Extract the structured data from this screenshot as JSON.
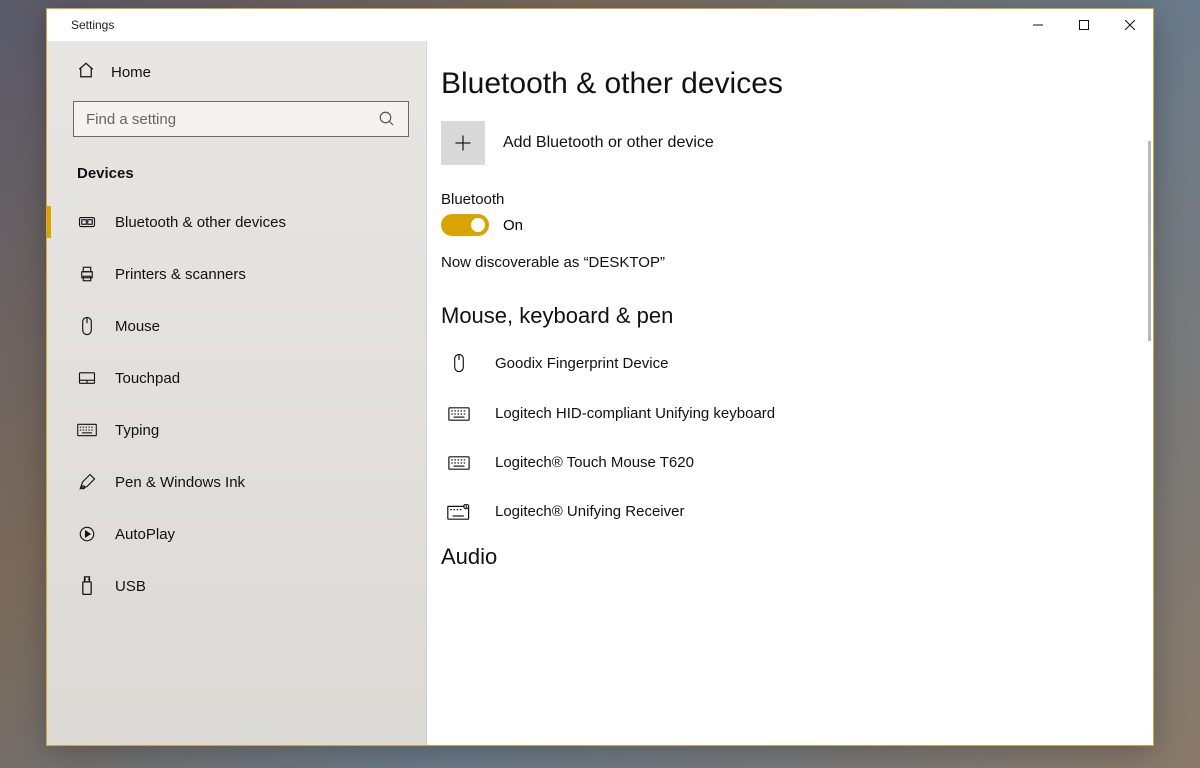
{
  "titlebar": {
    "title": "Settings"
  },
  "sidebar": {
    "home": "Home",
    "search_placeholder": "Find a setting",
    "category": "Devices",
    "items": [
      {
        "id": "bluetooth",
        "label": "Bluetooth & other devices",
        "icon": "bluetooth",
        "active": true
      },
      {
        "id": "printers",
        "label": "Printers & scanners",
        "icon": "printer"
      },
      {
        "id": "mouse",
        "label": "Mouse",
        "icon": "mouse"
      },
      {
        "id": "touchpad",
        "label": "Touchpad",
        "icon": "touchpad"
      },
      {
        "id": "typing",
        "label": "Typing",
        "icon": "keyboard"
      },
      {
        "id": "pen",
        "label": "Pen & Windows Ink",
        "icon": "pen"
      },
      {
        "id": "autoplay",
        "label": "AutoPlay",
        "icon": "autoplay"
      },
      {
        "id": "usb",
        "label": "USB",
        "icon": "usb"
      }
    ]
  },
  "page": {
    "title": "Bluetooth & other devices",
    "add_label": "Add Bluetooth or other device",
    "bt_heading": "Bluetooth",
    "toggle_state": "On",
    "discoverable": "Now discoverable as “DESKTOP”",
    "sections": [
      {
        "title": "Mouse, keyboard & pen",
        "devices": [
          {
            "label": "Goodix Fingerprint Device",
            "icon": "mouse"
          },
          {
            "label": "Logitech HID-compliant Unifying keyboard",
            "icon": "keyboard"
          },
          {
            "label": "Logitech® Touch Mouse T620",
            "icon": "keyboard"
          },
          {
            "label": "Logitech® Unifying Receiver",
            "icon": "keyboard-usb"
          }
        ]
      },
      {
        "title": "Audio",
        "devices": []
      }
    ]
  }
}
